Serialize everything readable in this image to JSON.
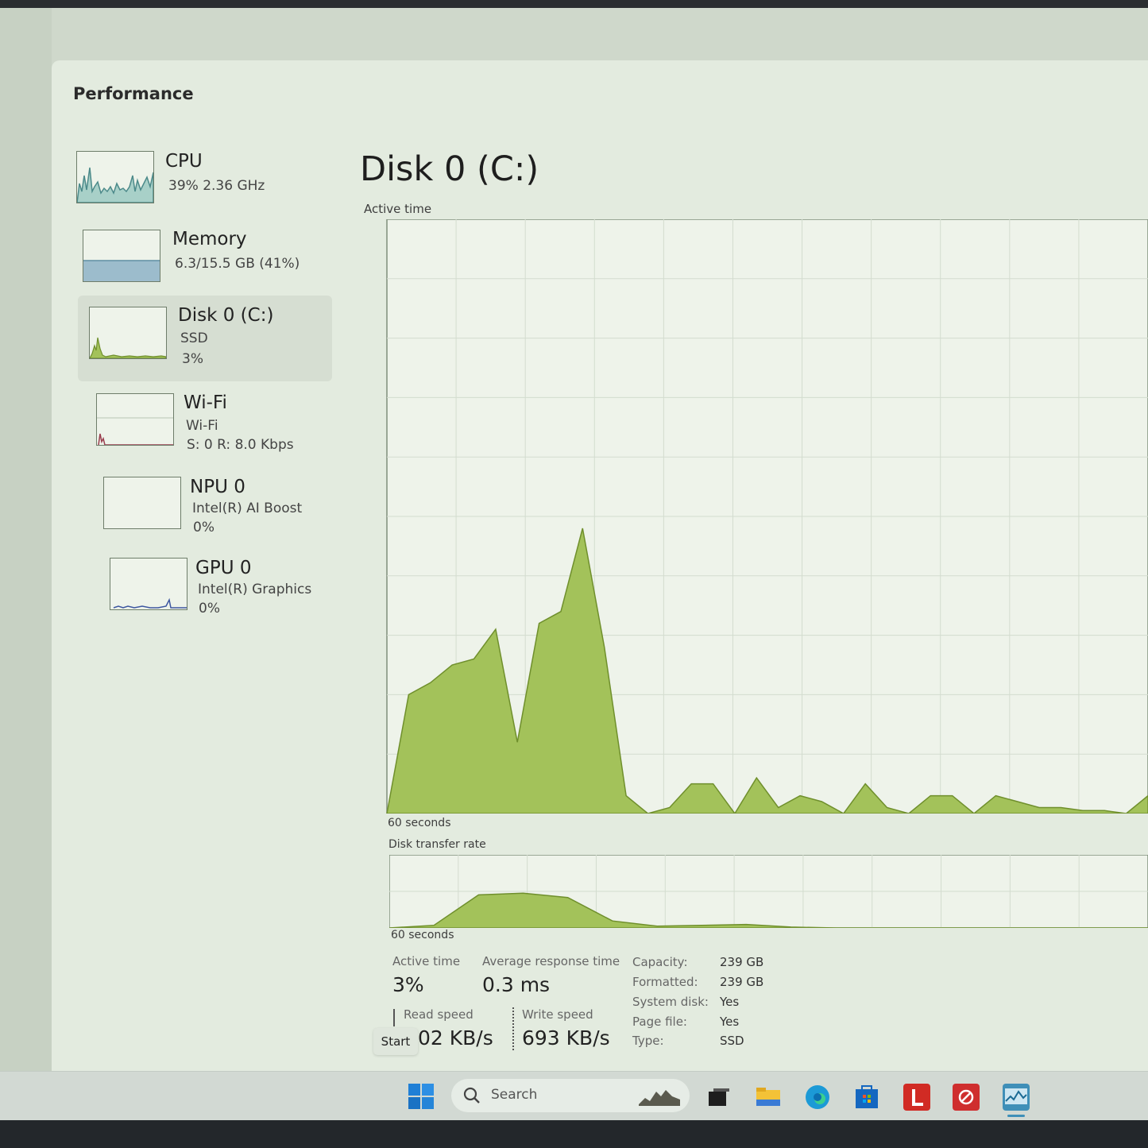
{
  "window": {
    "title": "Performance"
  },
  "sidebar": {
    "items": [
      {
        "name": "CPU",
        "line1": "39%  2.36 GHz",
        "line2": ""
      },
      {
        "name": "Memory",
        "line1": "6.3/15.5 GB (41%)",
        "line2": ""
      },
      {
        "name": "Disk 0 (C:)",
        "line1": "SSD",
        "line2": "3%"
      },
      {
        "name": "Wi-Fi",
        "line1": "Wi-Fi",
        "line2": "S: 0  R: 8.0 Kbps"
      },
      {
        "name": "NPU 0",
        "line1": "Intel(R) AI Boost",
        "line2": "0%"
      },
      {
        "name": "GPU 0",
        "line1": "Intel(R) Graphics",
        "line2": "0%"
      }
    ]
  },
  "main": {
    "title": "Disk 0 (C:)",
    "active_time_label": "Active time",
    "active_time_axis": "60 seconds",
    "transfer_label": "Disk transfer rate",
    "transfer_axis": "60 seconds"
  },
  "chart_data": [
    {
      "type": "area",
      "title": "Active time",
      "xlabel": "60 seconds",
      "ylim": [
        0,
        100
      ],
      "grid": true,
      "values": [
        0,
        20,
        22,
        25,
        26,
        31,
        12,
        32,
        34,
        48,
        28,
        3,
        0,
        1,
        5,
        5,
        0,
        6,
        1,
        3,
        2,
        0,
        5,
        1,
        0,
        3,
        3,
        0,
        3,
        2,
        1,
        1,
        0.5,
        0.5,
        0,
        3
      ]
    },
    {
      "type": "area",
      "title": "Disk transfer rate",
      "xlabel": "60 seconds",
      "grid": true,
      "values": [
        0,
        3,
        38,
        40,
        35,
        8,
        2,
        3,
        4,
        1,
        0,
        0,
        0,
        0,
        0,
        0,
        0,
        0
      ]
    }
  ],
  "stats": {
    "active_time": {
      "label": "Active time",
      "value": "3%"
    },
    "avg_response": {
      "label": "Average response time",
      "value": "0.3 ms"
    },
    "read_speed": {
      "label": "Read speed",
      "value": "02 KB/s"
    },
    "write_speed": {
      "label": "Write speed",
      "value": "693 KB/s"
    }
  },
  "properties": [
    {
      "key": "Capacity:",
      "value": "239 GB"
    },
    {
      "key": "Formatted:",
      "value": "239 GB"
    },
    {
      "key": "System disk:",
      "value": "Yes"
    },
    {
      "key": "Page file:",
      "value": "Yes"
    },
    {
      "key": "Type:",
      "value": "SSD"
    }
  ],
  "taskbar": {
    "start_tooltip": "Start",
    "search_placeholder": "Search",
    "icons": [
      "windows-start-icon",
      "search-icon",
      "terminal-icon",
      "file-explorer-icon",
      "edge-icon",
      "store-icon",
      "red-l-app-icon",
      "red-app-icon",
      "task-manager-icon"
    ]
  },
  "colors": {
    "disk_fill": "#a3c25a",
    "disk_stroke": "#6f8f2c",
    "memory_fill": "#9cbccc",
    "cpu_stroke": "#4c8a8a",
    "wifi_stroke": "#9a3d4e",
    "gpu_stroke": "#3d56a0"
  }
}
